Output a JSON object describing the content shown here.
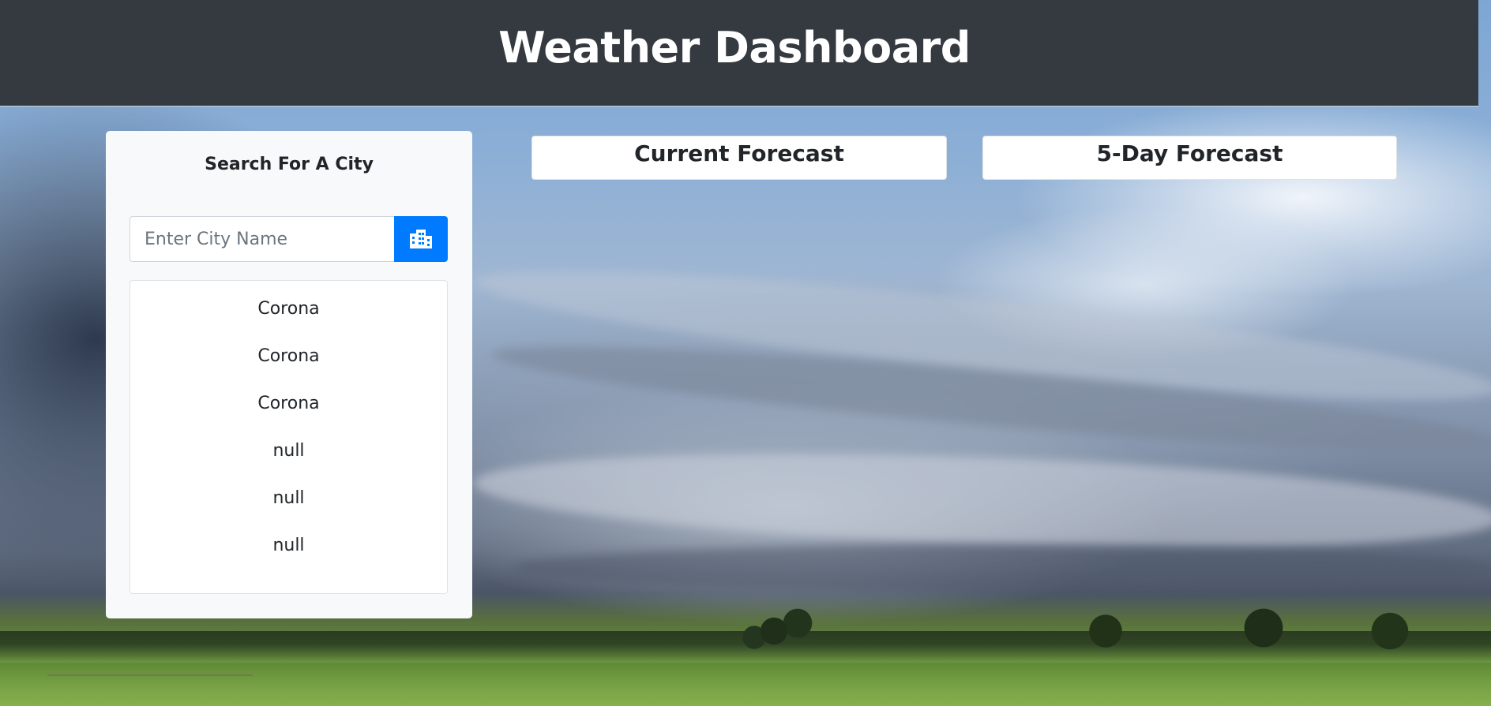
{
  "header": {
    "title": "Weather Dashboard"
  },
  "search": {
    "title": "Search For A City",
    "placeholder": "Enter City Name",
    "button_icon": "city-icon",
    "history": [
      "Corona",
      "Corona",
      "Corona",
      "null",
      "null",
      "null"
    ]
  },
  "forecast": {
    "current_title": "Current Forecast",
    "five_day_title": "5-Day Forecast"
  },
  "colors": {
    "header_bg": "#343a40",
    "accent": "#007bff",
    "card_bg": "#f8f9fa"
  }
}
